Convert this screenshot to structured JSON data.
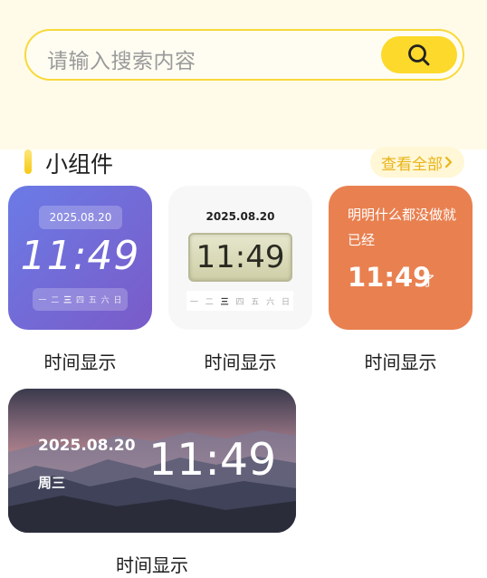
{
  "search": {
    "placeholder": "请输入搜索内容",
    "button_icon": "search-icon"
  },
  "section": {
    "title": "小组件",
    "view_all_label": "查看全部",
    "view_all_icon": "chevron-right-icon"
  },
  "colors": {
    "accent_yellow": "#fcd92a",
    "header_bg": "#fffbe8",
    "orange_card": "#e98050"
  },
  "widgets": [
    {
      "label": "时间显示",
      "date": "2025.08.20",
      "time": "11:49",
      "weekdays": [
        "一",
        "二",
        "三",
        "四",
        "五",
        "六",
        "日"
      ],
      "active_weekday": "三"
    },
    {
      "label": "时间显示",
      "date": "2025.08.20",
      "time": "11:49",
      "weekdays": [
        "一",
        "二",
        "三",
        "四",
        "五",
        "六",
        "日"
      ],
      "active_weekday": "三"
    },
    {
      "label": "时间显示",
      "message": "明明什么都没做就已经",
      "time": "11:49",
      "suffix": "了"
    },
    {
      "label": "时间显示",
      "date": "2025.08.20",
      "weekday": "周三",
      "time": "11:49"
    }
  ]
}
